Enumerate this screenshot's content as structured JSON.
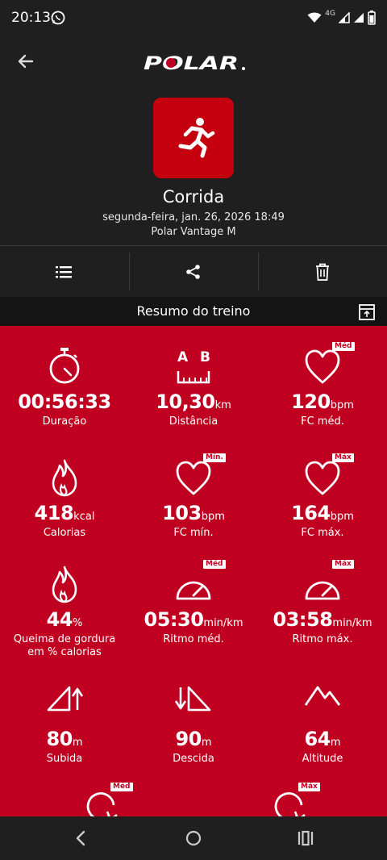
{
  "status_bar": {
    "time": "20:13",
    "network": "4G"
  },
  "header": {
    "brand": "POLAR"
  },
  "activity": {
    "name": "Corrida",
    "date": "segunda-feira, jan. 26, 2026 18:49",
    "device": "Polar Vantage M"
  },
  "summary": {
    "title": "Resumo do treino"
  },
  "metrics": [
    {
      "value": "00:56:33",
      "unit": "",
      "label": "Duração",
      "badge": ""
    },
    {
      "value": "10,30",
      "unit": "km",
      "label": "Distância",
      "badge": ""
    },
    {
      "value": "120",
      "unit": "bpm",
      "label": "FC méd.",
      "badge": "Méd"
    },
    {
      "value": "418",
      "unit": "kcal",
      "label": "Calorias",
      "badge": ""
    },
    {
      "value": "103",
      "unit": "bpm",
      "label": "FC mín.",
      "badge": "Mín."
    },
    {
      "value": "164",
      "unit": "bpm",
      "label": "FC máx.",
      "badge": "Máx"
    },
    {
      "value": "44",
      "unit": "%",
      "label": "Queima de gordura em % calorias",
      "badge": ""
    },
    {
      "value": "05:30",
      "unit": "min/km",
      "label": "Ritmo méd.",
      "badge": "Méd"
    },
    {
      "value": "03:58",
      "unit": "min/km",
      "label": "Ritmo máx.",
      "badge": "Máx"
    },
    {
      "value": "80",
      "unit": "m",
      "label": "Subida",
      "badge": ""
    },
    {
      "value": "90",
      "unit": "m",
      "label": "Descida",
      "badge": ""
    },
    {
      "value": "64",
      "unit": "m",
      "label": "Altitude",
      "badge": ""
    },
    {
      "badge": "Méd"
    },
    {
      "badge": "Máx"
    }
  ],
  "colors": {
    "accent": "#c00020",
    "tile": "#c4000f",
    "background": "#1f1f1f"
  }
}
